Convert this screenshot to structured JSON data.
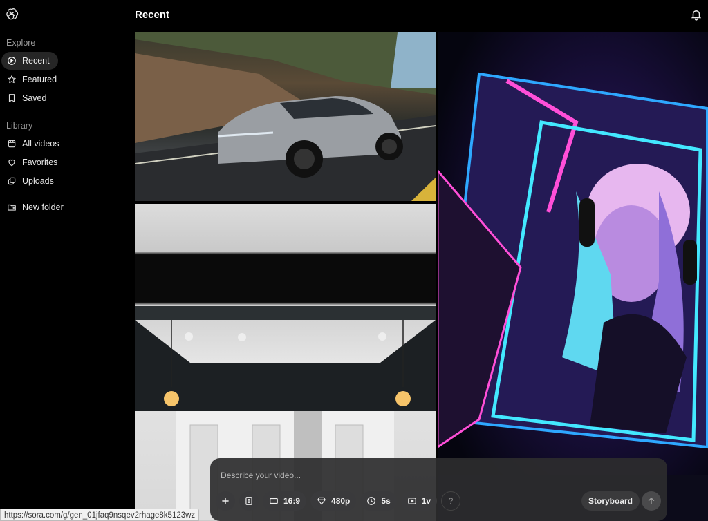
{
  "header": {
    "title": "Recent",
    "logo_icon": "openai-logo-icon",
    "bell_icon": "bell-icon"
  },
  "sidebar": {
    "explore_label": "Explore",
    "explore_items": [
      {
        "label": "Recent",
        "icon": "play-circle-icon",
        "active": true
      },
      {
        "label": "Featured",
        "icon": "star-icon",
        "active": false
      },
      {
        "label": "Saved",
        "icon": "bookmark-icon",
        "active": false
      }
    ],
    "library_label": "Library",
    "library_items": [
      {
        "label": "All videos",
        "icon": "video-grid-icon"
      },
      {
        "label": "Favorites",
        "icon": "heart-icon"
      },
      {
        "label": "Uploads",
        "icon": "uploads-icon"
      }
    ],
    "new_folder_label": "New folder"
  },
  "gallery": {
    "tiles": [
      {
        "name": "car-video-tile"
      },
      {
        "name": "interior-video-tile"
      },
      {
        "name": "neon-portrait-tile"
      }
    ]
  },
  "composer": {
    "placeholder": "Describe your video...",
    "aspect_ratio": "16:9",
    "resolution": "480p",
    "duration": "5s",
    "variations": "1v",
    "help_label": "?",
    "storyboard_label": "Storyboard"
  },
  "status_bar": {
    "url": "https://sora.com/g/gen_01jfaq9nsqev2rhage8k5123wz"
  },
  "colors": {
    "background": "#000000",
    "active_nav": "#262626",
    "composer_bg": "#2c2c2e"
  }
}
